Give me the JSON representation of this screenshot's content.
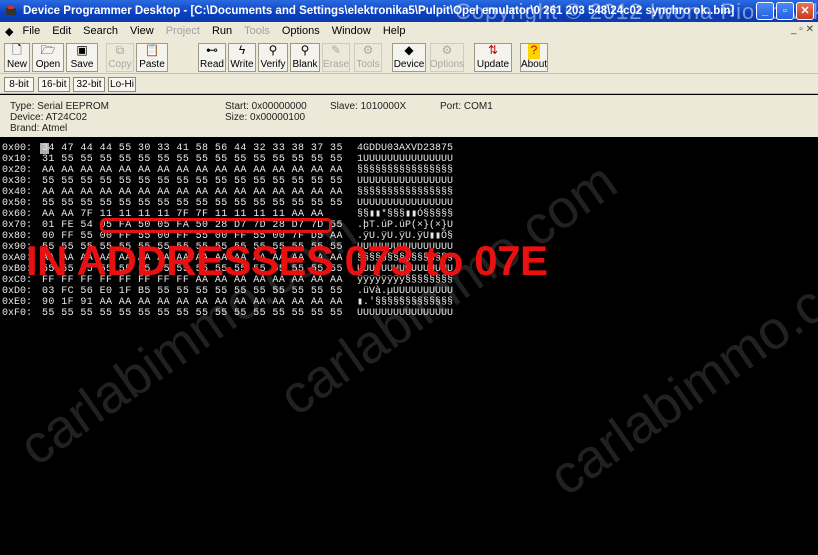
{
  "window": {
    "title": "Device Programmer Desktop - [C:\\Documents and Settings\\elektronika5\\Pulpit\\Opel emulator\\0 261 203 548\\24c02 synchro ok..bin]",
    "watermark": "Copyright © 2012 Iwona Piotrowska"
  },
  "menu": {
    "items": [
      "File",
      "Edit",
      "Search",
      "View",
      "Project",
      "Run",
      "Tools",
      "Options",
      "Window",
      "Help"
    ],
    "disabled": [
      "Project",
      "Tools"
    ]
  },
  "toolbar": {
    "buttons": [
      {
        "label": "New",
        "icon": "new-file-icon",
        "enabled": true
      },
      {
        "label": "Open",
        "icon": "open-folder-icon",
        "enabled": true
      },
      {
        "label": "Save",
        "icon": "save-icon",
        "enabled": true
      },
      {
        "label": "Copy",
        "icon": "copy-icon",
        "enabled": false
      },
      {
        "label": "Paste",
        "icon": "paste-icon",
        "enabled": true
      },
      {
        "label": "Read",
        "icon": "read-chip-icon",
        "enabled": true
      },
      {
        "label": "Write",
        "icon": "write-lightning-icon",
        "enabled": true
      },
      {
        "label": "Verify",
        "icon": "verify-magnifier-icon",
        "enabled": true
      },
      {
        "label": "Blank",
        "icon": "blank-check-icon",
        "enabled": true
      },
      {
        "label": "Erase",
        "icon": "erase-brush-icon",
        "enabled": false
      },
      {
        "label": "Tools",
        "icon": "tools-icon",
        "enabled": false
      },
      {
        "label": "Device",
        "icon": "device-chip-icon",
        "enabled": true
      },
      {
        "label": "Options",
        "icon": "options-icon",
        "enabled": false
      },
      {
        "label": "Update",
        "icon": "update-arrows-icon",
        "enabled": true
      },
      {
        "label": "About",
        "icon": "question-icon",
        "enabled": true
      }
    ]
  },
  "view_buttons": [
    "8-bit",
    "16-bit",
    "32-bit",
    "Lo-Hi"
  ],
  "device_info": {
    "type": "Type: Serial EEPROM",
    "device": "Device: AT24C02",
    "brand": "Brand: Atmel",
    "start": "Start: 0x00000000",
    "size": "Size: 0x00000100",
    "slave": "Slave: 1010000X",
    "port": "Port: COM1"
  },
  "hex_rows": [
    {
      "addr": "0x00:",
      "hex": "34 47 44 44 55 30 33 41 58 56 44 32 33 38 37 35",
      "ascii": "4GDDU03AXVD23875"
    },
    {
      "addr": "0x10:",
      "hex": "31 55 55 55 55 55 55 55 55 55 55 55 55 55 55 55",
      "ascii": "1UUUUUUUUUUUUUUU"
    },
    {
      "addr": "0x20:",
      "hex": "AA AA AA AA AA AA AA AA AA AA AA AA AA AA AA AA",
      "ascii": "§§§§§§§§§§§§§§§§"
    },
    {
      "addr": "0x30:",
      "hex": "55 55 55 55 55 55 55 55 55 55 55 55 55 55 55 55",
      "ascii": "UUUUUUUUUUUUUUUU"
    },
    {
      "addr": "0x40:",
      "hex": "AA AA AA AA AA AA AA AA AA AA AA AA AA AA AA AA",
      "ascii": "§§§§§§§§§§§§§§§§"
    },
    {
      "addr": "0x50:",
      "hex": "55 55 55 55 55 55 55 55 55 55 55 55 55 55 55 55",
      "ascii": "UUUUUUUUUUUUUUUU"
    },
    {
      "addr": "0x60:",
      "hex": "AA AA 7F 11 11 11 11 7F 7F 11 11 11 11 AA AA",
      "ascii": "§§▮▮*§§§▮▮Ó§§§§§"
    },
    {
      "addr": "0x70:",
      "hex": "01 FE 54 05 FA 50 05 FA 50 28 D7 7D 28 D7 7D 55",
      "ascii": ".þT.úP.úP(×}(×}U"
    },
    {
      "addr": "0x80:",
      "hex": "00 FF 55 00 FF 55 00 FF 55 00 FF 55 00 7F D5 AA",
      "ascii": ".ÿU.ÿU.ÿU.ÿU▮▮Õ§"
    },
    {
      "addr": "0x90:",
      "hex": "55 55 55 55 55 55 55 55 55 55 55 55 55 55 55 55",
      "ascii": "UUUUUUUUUUUUUUUU"
    },
    {
      "addr": "0xA0:",
      "hex": "AA AA AA AA AA AA AA AA AA AA AA AA AA AA AA AA",
      "ascii": "§§§§§§§§§§§§§§§§"
    },
    {
      "addr": "0xB0:",
      "hex": "55 55 55 55 55 55 55 55 55 55 55 55 55 55 55 55",
      "ascii": "UUUUUUUUUUUUUUUU"
    },
    {
      "addr": "0xC0:",
      "hex": "FF FF FF FF FF FF FF FF AA AA AA AA AA AA AA AA",
      "ascii": "ÿÿÿÿÿÿÿÿ§§§§§§§§"
    },
    {
      "addr": "0xD0:",
      "hex": "03 FC 56 E0 1F B5 55 55 55 55 55 55 55 55 55 55",
      "ascii": ".üVà.µUUUUUUUUUU"
    },
    {
      "addr": "0xE0:",
      "hex": "90 1F 91 AA AA AA AA AA AA AA AA AA AA AA AA AA",
      "ascii": "▮.'§§§§§§§§§§§§§"
    },
    {
      "addr": "0xF0:",
      "hex": "55 55 55 55 55 55 55 55 55 55 55 55 55 55 55 55",
      "ascii": "UUUUUUUUUUUUUUUU"
    }
  ],
  "annotation": {
    "text": "IN ADDRESSES 073 to 07E",
    "color": "#e81010"
  },
  "bg_watermarks": [
    "carlabimmo.com",
    "carlabimmo.com",
    "carlabimmo.com"
  ],
  "colors": {
    "titlebar": "#0a3fbf",
    "chrome": "#ece9d8",
    "hex_bg": "#000000",
    "highlight": "#e01414"
  }
}
